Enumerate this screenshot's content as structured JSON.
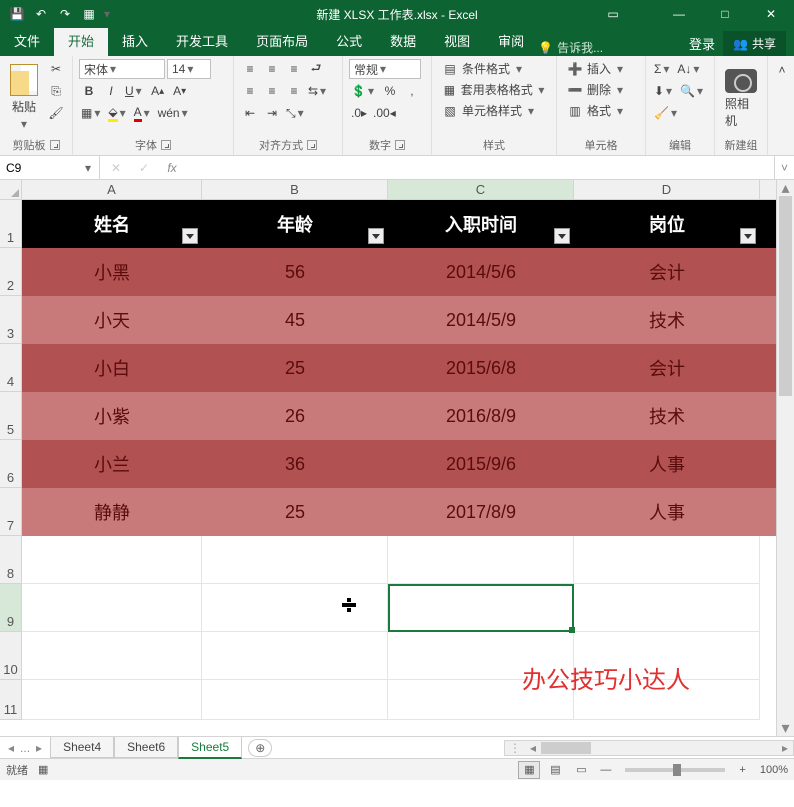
{
  "titlebar": {
    "title": "新建 XLSX 工作表.xlsx - Excel"
  },
  "tabs": {
    "file": "文件",
    "home": "开始",
    "insert": "插入",
    "developer": "开发工具",
    "pagelayout": "页面布局",
    "formulas": "公式",
    "data": "数据",
    "view": "视图",
    "review": "审阅",
    "tellme": "告诉我...",
    "login": "登录",
    "share": "共享"
  },
  "ribbon": {
    "clipboard": {
      "label": "剪贴板",
      "paste": "粘贴"
    },
    "font": {
      "label": "字体",
      "name": "宋体",
      "size": "14"
    },
    "alignment": {
      "label": "对齐方式"
    },
    "number": {
      "label": "数字",
      "format": "常规"
    },
    "styles": {
      "label": "样式",
      "cond": "条件格式",
      "table": "套用表格格式",
      "cell": "单元格样式"
    },
    "cells": {
      "label": "单元格",
      "insert": "插入",
      "delete": "删除",
      "format": "格式"
    },
    "editing": {
      "label": "编辑"
    },
    "camera": {
      "label": "新建组",
      "btn": "照相机"
    }
  },
  "namebox": "C9",
  "columns": [
    "A",
    "B",
    "C",
    "D"
  ],
  "rowlabels": [
    "1",
    "2",
    "3",
    "4",
    "5",
    "6",
    "7",
    "8",
    "9",
    "10",
    "11"
  ],
  "table": {
    "headers": [
      "姓名",
      "年龄",
      "入职时间",
      "岗位"
    ],
    "rows": [
      [
        "小黑",
        "56",
        "2014/5/6",
        "会计"
      ],
      [
        "小天",
        "45",
        "2014/5/9",
        "技术"
      ],
      [
        "小白",
        "25",
        "2015/6/8",
        "会计"
      ],
      [
        "小紫",
        "26",
        "2016/8/9",
        "技术"
      ],
      [
        "小兰",
        "36",
        "2015/9/6",
        "人事"
      ],
      [
        "静静",
        "25",
        "2017/8/9",
        "人事"
      ]
    ]
  },
  "watermark": "办公技巧小达人",
  "sheets": {
    "dots": "...",
    "s4": "Sheet4",
    "s6": "Sheet6",
    "s5": "Sheet5"
  },
  "status": {
    "ready": "就绪",
    "zoom": "100%"
  }
}
